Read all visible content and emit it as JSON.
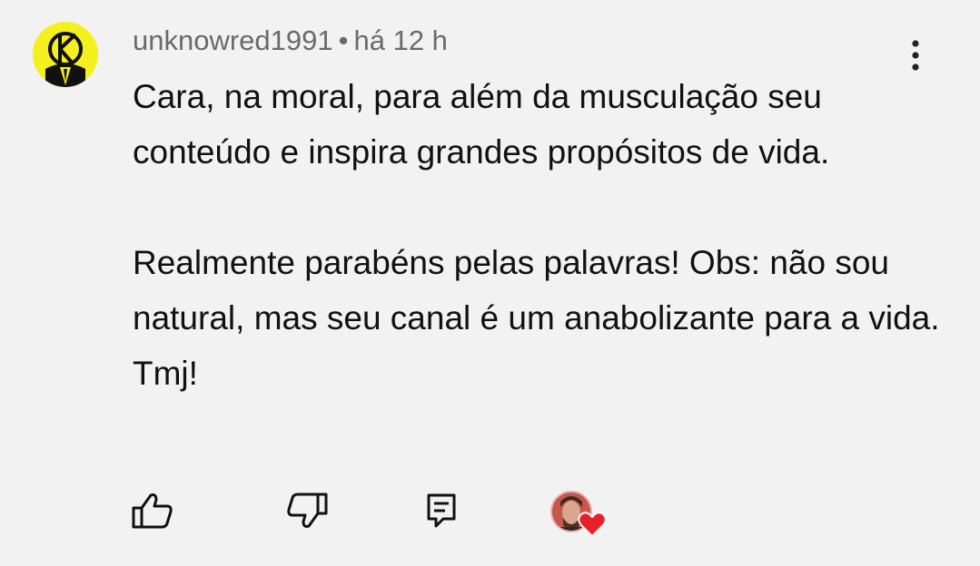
{
  "comment": {
    "author": "unknowred1991",
    "separator": "•",
    "time": "há 12 h",
    "text": "Cara, na moral, para além da musculação seu conteúdo e inspira grandes propósitos de vida.\n\nRealmente parabéns pelas palavras! Obs: não sou natural, mas seu canal é um anabolizante para a vida. Tmj!"
  },
  "icons": {
    "avatar": "user-avatar",
    "more": "more-vertical-icon",
    "like": "thumbs-up-icon",
    "dislike": "thumbs-down-icon",
    "reply": "comment-reply-icon",
    "hearted": "creator-heart-badge"
  },
  "colors": {
    "background": "#f2f2f2",
    "text": "#111111",
    "meta": "#6a6a6a",
    "avatar_bg": "#f4ef1e",
    "heart": "#e8202a"
  }
}
